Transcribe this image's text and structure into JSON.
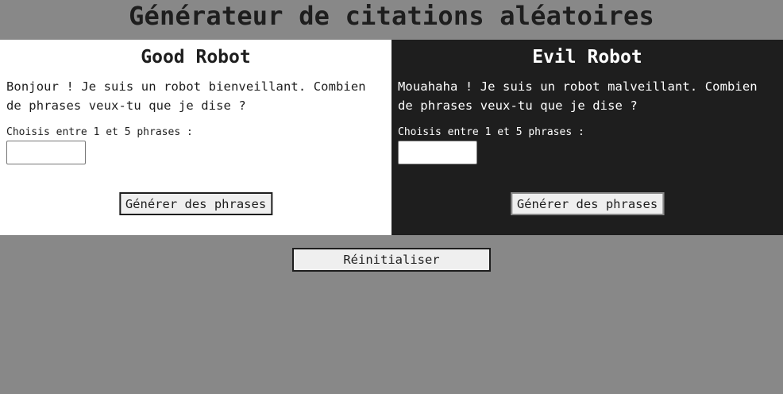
{
  "header": {
    "title": "Générateur de citations aléatoires"
  },
  "good_robot": {
    "title": "Good Robot",
    "intro": "Bonjour ! Je suis un robot bienveillant. Combien de phrases veux-tu que je dise ?",
    "input_label": "Choisis entre 1 et 5 phrases :",
    "input_value": "",
    "button_label": "Générer des phrases",
    "background": "#ffffff",
    "text_color": "#1e1e1e"
  },
  "evil_robot": {
    "title": "Evil Robot",
    "intro": "Mouahaha ! Je suis un robot malveillant. Combien de phrases veux-tu que je dise ?",
    "input_label": "Choisis entre 1 et 5 phrases :",
    "input_value": "",
    "button_label": "Générer des phrases",
    "background": "#1e1e1e",
    "text_color": "#ffffff"
  },
  "reset": {
    "button_label": "Réinitialiser"
  },
  "colors": {
    "page_background": "#888888",
    "button_background": "#efefef"
  }
}
